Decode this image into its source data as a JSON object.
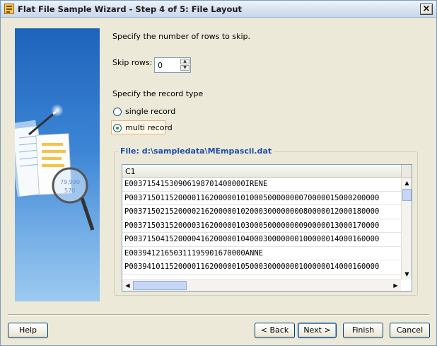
{
  "window": {
    "title": "Flat File Sample Wizard - Step 4 of 5: File Layout",
    "app_icon": "wizard-icon",
    "close_glyph": "×"
  },
  "skip": {
    "instruction": "Specify the number of rows to skip.",
    "label": "Skip rows:",
    "value": "0",
    "up_glyph": "▲",
    "down_glyph": "▼"
  },
  "record_type": {
    "instruction": "Specify the record type",
    "options": [
      {
        "label": "single record",
        "checked": false
      },
      {
        "label": "multi record",
        "checked": true
      }
    ]
  },
  "file": {
    "title": "File: d:\\sampledata\\MEmpascii.dat",
    "column_header": "C1",
    "rows": [
      "E00371541530906198701400000IRENE",
      "P00371501152000011620000010100050000000070000015000200000",
      "P00371502152000021620000010200030000000080000012000180000",
      "P00371503152000031620000010300050000000090000013000170000",
      "P00371504152000041620000010400030000000100000014000160000",
      "E00394121650311195901670000ANNE",
      "P00394101152000011620000010500030000000100000014000160000"
    ]
  },
  "buttons": {
    "help": "Help",
    "back": "< Back",
    "next": "Next >",
    "finish": "Finish",
    "cancel": "Cancel"
  },
  "colors": {
    "accent": "#1f4ea8",
    "window_bg": "#ece9d8",
    "side_panel": "#1e6fc8"
  }
}
